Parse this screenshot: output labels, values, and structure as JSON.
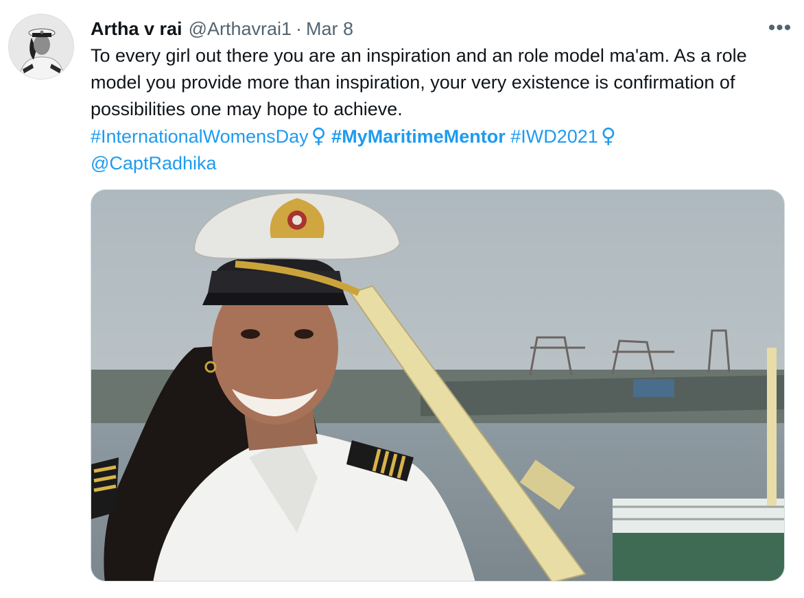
{
  "tweet": {
    "author": {
      "display_name": "Artha v rai",
      "handle": "@Arthavrai1",
      "avatar_icon": "avatar-photo"
    },
    "separator": "·",
    "date": "Mar 8",
    "more_icon": "more-options-icon",
    "more_label": "•••",
    "text_line": "To every girl out there you are an inspiration and an role model ma'am. As a role model you provide more than inspiration, your very existence is confirmation of possibilities one may hope to achieve.",
    "hashtags": [
      "#InternationalWomensDay",
      "#MyMaritimeMentor",
      "#IWD2021"
    ],
    "emoji": "♀",
    "mention": "@CaptRadhika",
    "media_icon": "tweet-photo",
    "link_color": "#1d9bf0",
    "secondary_text_color": "#536471"
  }
}
